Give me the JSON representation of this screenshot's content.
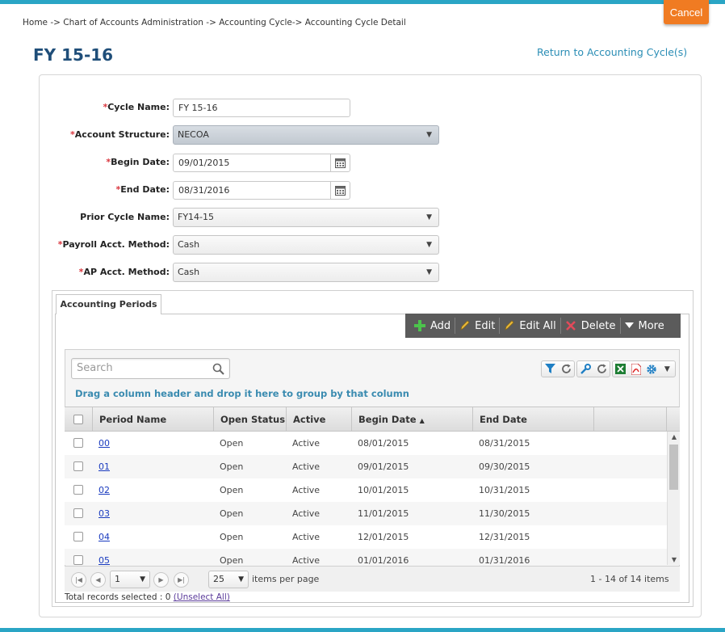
{
  "breadcrumb": "Home -> Chart of Accounts Administration -> Accounting Cycle-> Accounting Cycle Detail",
  "cancel_label": "Cancel",
  "page_title": "FY 15-16",
  "return_link": "Return to Accounting Cycle(s)",
  "form": {
    "cycle_name": {
      "label": "Cycle Name:",
      "value": "FY 15-16"
    },
    "account_structure": {
      "label": "Account Structure:",
      "value": "NECOA"
    },
    "begin_date": {
      "label": "Begin Date:",
      "value": "09/01/2015"
    },
    "end_date": {
      "label": "End Date:",
      "value": "08/31/2016"
    },
    "prior_cycle": {
      "label": "Prior Cycle Name:",
      "value": "FY14-15"
    },
    "payroll_method": {
      "label": "Payroll Acct. Method:",
      "value": "Cash"
    },
    "ap_method": {
      "label": "AP Acct. Method:",
      "value": "Cash"
    }
  },
  "tab_label": "Accounting Periods",
  "toolbar": {
    "add": "Add",
    "edit": "Edit",
    "edit_all": "Edit All",
    "delete": "Delete",
    "more": "More"
  },
  "search_placeholder": "Search",
  "group_hint": "Drag a column header and drop it here to group by that column",
  "columns": {
    "period_name": "Period Name",
    "open_status": "Open Status",
    "active": "Active",
    "begin_date": "Begin Date",
    "end_date": "End Date"
  },
  "rows": [
    {
      "period": "00",
      "status": "Open",
      "active": "Active",
      "begin": "08/01/2015",
      "end": "08/31/2015"
    },
    {
      "period": "01",
      "status": "Open",
      "active": "Active",
      "begin": "09/01/2015",
      "end": "09/30/2015"
    },
    {
      "period": "02",
      "status": "Open",
      "active": "Active",
      "begin": "10/01/2015",
      "end": "10/31/2015"
    },
    {
      "period": "03",
      "status": "Open",
      "active": "Active",
      "begin": "11/01/2015",
      "end": "11/30/2015"
    },
    {
      "period": "04",
      "status": "Open",
      "active": "Active",
      "begin": "12/01/2015",
      "end": "12/31/2015"
    },
    {
      "period": "05",
      "status": "Open",
      "active": "Active",
      "begin": "01/01/2016",
      "end": "01/31/2016"
    }
  ],
  "pager": {
    "page": "1",
    "page_size": "25",
    "items_per_page": "items per page",
    "summary": "1 - 14 of 14 items"
  },
  "total_selected": {
    "text": "Total records selected : 0",
    "unselect": "(Unselect All)"
  },
  "colors": {
    "accent": "#2aa5c5",
    "cancel": "#f07b22",
    "title": "#1f4e79",
    "required": "#d9363e"
  }
}
